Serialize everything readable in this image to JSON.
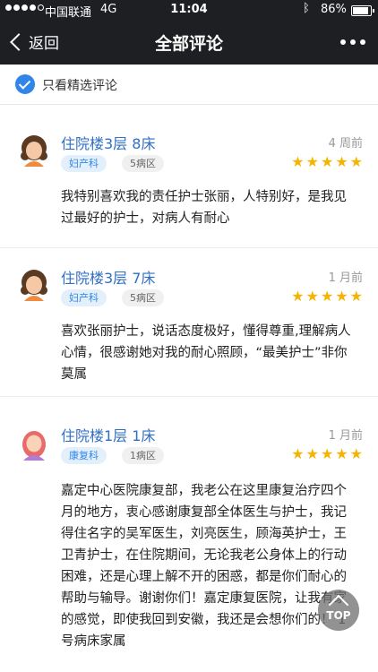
{
  "status_bar": {
    "carrier": "中国联通",
    "network": "4G",
    "time": "11:04",
    "battery": "86%",
    "bluetooth_icon": "bluetooth-icon"
  },
  "nav": {
    "back_label": "返回",
    "title": "全部评论",
    "more_icon": "more-dots-icon"
  },
  "filter": {
    "label": "只看精选评论",
    "checked": true
  },
  "colors": {
    "accent": "#2f86e8",
    "star": "#f5b400",
    "bar": "#1e1f22",
    "ward_text": "#2f6fc7"
  },
  "reviews": [
    {
      "ward": "住院楼3层 8床",
      "time": "4 周前",
      "dept": "妇产科",
      "area": "5病区",
      "stars": 5,
      "content": "我特别喜欢我的责任护士张丽，人特别好，是我见过最好的护士，对病人有耐心"
    },
    {
      "ward": "住院楼3层 7床",
      "time": "1 月前",
      "dept": "妇产科",
      "area": "5病区",
      "stars": 5,
      "content": "喜欢张丽护士，说话态度极好，懂得尊重,理解病人心情，很感谢她对我的耐心照顾，“最美护士”非你莫属"
    },
    {
      "ward": "住院楼1层 1床",
      "time": "1 月前",
      "dept": "康复科",
      "area": "1病区",
      "stars": 5,
      "content": "嘉定中心医院康复部，我老公在这里康复治疗四个月的地方，衷心感谢康复部全体医生与护士，我记得住名字的吴军医生，刘亮医生，顾海英护士，王卫青护士，在住院期间，无论我老公身体上的行动困难，还是心理上解不开的困惑，都是你们耐心的帮助与输导。谢谢你们！嘉定康复医院，让我有家的感觉，即使我回到安徽，我还是会想你们的！ 1号病床家属"
    }
  ],
  "top_button": {
    "label": "TOP"
  }
}
